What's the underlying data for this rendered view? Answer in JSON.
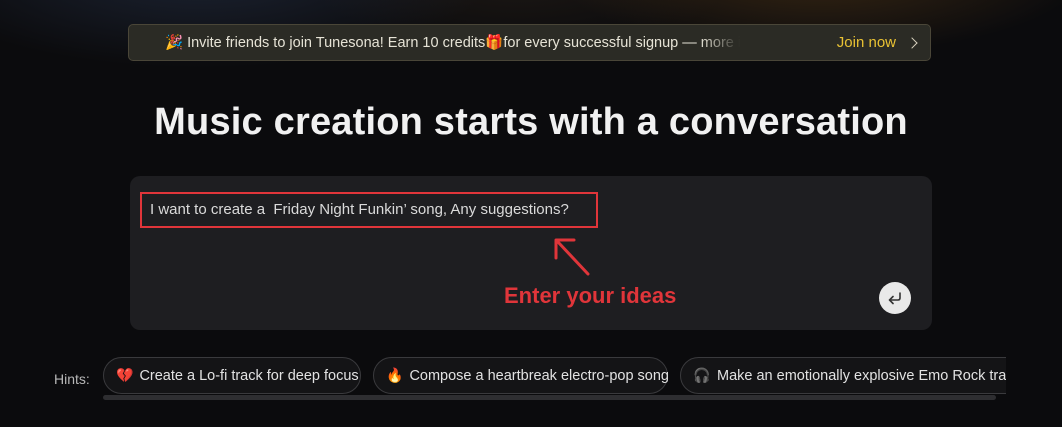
{
  "banner": {
    "emoji_left": "🎉",
    "text": "Invite friends to join Tunesona! Earn 10 credits ",
    "gift_emoji": "🎁",
    "text_after": " for every successful signup — more invite",
    "join_label": "Join now",
    "accent_color": "#e9c233"
  },
  "heading": "Music creation starts with a conversation",
  "chat": {
    "input_value": "I want to create a  Friday Night Funkin’ song, Any suggestions?",
    "send_icon": "enter-return-icon"
  },
  "annotation": {
    "text": "Enter your ideas",
    "color": "#e0353a"
  },
  "hints": {
    "label": "Hints:",
    "items": [
      {
        "emoji": "💔",
        "text": "Create a Lo-fi track for deep focus"
      },
      {
        "emoji": "🔥",
        "text": "Compose a heartbreak electro-pop song"
      },
      {
        "emoji": "🎧",
        "text": "Make an emotionally explosive Emo Rock track"
      }
    ]
  }
}
